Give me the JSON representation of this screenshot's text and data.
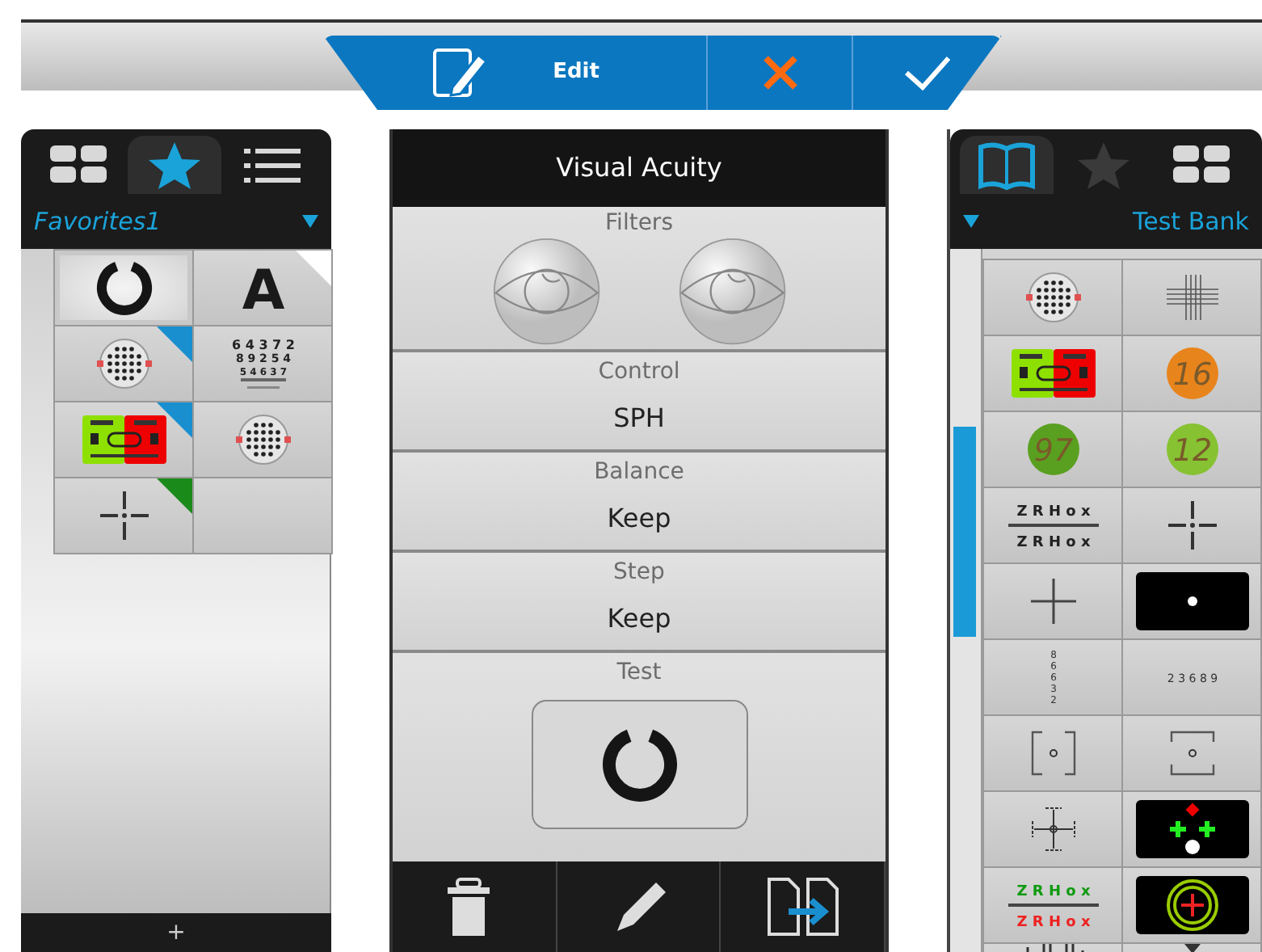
{
  "toolbar": {
    "title": "Edit",
    "buttons": [
      {
        "kind": "cancel"
      },
      {
        "kind": "confirm"
      }
    ]
  },
  "favorites_panel": {
    "tabs": [
      {
        "kind": "grid",
        "selected": false
      },
      {
        "kind": "star",
        "selected": true
      },
      {
        "kind": "list",
        "selected": false
      }
    ],
    "dropdown": "Favorites1",
    "tiles": [
      {
        "kind": "ring",
        "selected": true
      },
      {
        "kind": "letter",
        "text": [
          "A"
        ],
        "selected": false,
        "color": "#ffffff"
      },
      {
        "kind": "dotgrid",
        "selected": false,
        "color": "#1a8fd0"
      },
      {
        "kind": "letter-chart",
        "text": [
          "6 4 3 7 2",
          "8 9 2 5 4",
          "5 4 6 3 7"
        ],
        "selected": false
      },
      {
        "kind": "duochrome",
        "selected": false,
        "color": "#1a8fd0"
      },
      {
        "kind": "dotgrid",
        "selected": false
      },
      {
        "kind": "cross",
        "selected": false,
        "color": "#1a8a1a"
      },
      {
        "kind": "blank",
        "selected": false
      }
    ],
    "add_button": "+"
  },
  "setup_panel": {
    "title": "Visual Acuity",
    "sections": [
      {
        "kind": "filters",
        "label": "Filters"
      },
      {
        "kind": "value",
        "label": "Control",
        "value": "SPH"
      },
      {
        "kind": "value",
        "label": "Balance",
        "value": "Keep"
      },
      {
        "kind": "value",
        "label": "Step",
        "value": "Keep"
      },
      {
        "kind": "test",
        "label": "Test"
      }
    ],
    "actions": [
      {
        "kind": "delete"
      },
      {
        "kind": "edit"
      },
      {
        "kind": "copy"
      }
    ]
  },
  "test_bank_panel": {
    "tabs": [
      {
        "kind": "book",
        "selected": true
      },
      {
        "kind": "star",
        "selected": false
      },
      {
        "kind": "grid",
        "selected": false
      }
    ],
    "dropdown": "Test Bank",
    "tiles": [
      {
        "kind": "dotgrid"
      },
      {
        "kind": "line-grid"
      },
      {
        "kind": "duochrome"
      },
      {
        "kind": "plate",
        "color": "#e8841c",
        "text": [
          "16"
        ]
      },
      {
        "kind": "plate",
        "color": "#5aa020",
        "text": [
          "97"
        ]
      },
      {
        "kind": "plate",
        "color": "#86c232",
        "text": [
          "12"
        ]
      },
      {
        "kind": "zr-chart",
        "text": [
          "Z R H o x",
          "Z R H o x"
        ]
      },
      {
        "kind": "cross"
      },
      {
        "kind": "thin-cross"
      },
      {
        "kind": "dot"
      },
      {
        "kind": "vertical-digits",
        "text": [
          "8",
          "6",
          "6",
          "3",
          "2"
        ]
      },
      {
        "kind": "digits",
        "text": [
          "2 3 6 8 9"
        ]
      },
      {
        "kind": "brackets"
      },
      {
        "kind": "corners"
      },
      {
        "kind": "crosshair"
      },
      {
        "kind": "worth"
      },
      {
        "kind": "zr-duochrome",
        "text": [
          "Z R H o x",
          "Z R H o x"
        ]
      },
      {
        "kind": "target"
      },
      {
        "kind": "bars"
      },
      {
        "kind": "triangle"
      }
    ]
  }
}
